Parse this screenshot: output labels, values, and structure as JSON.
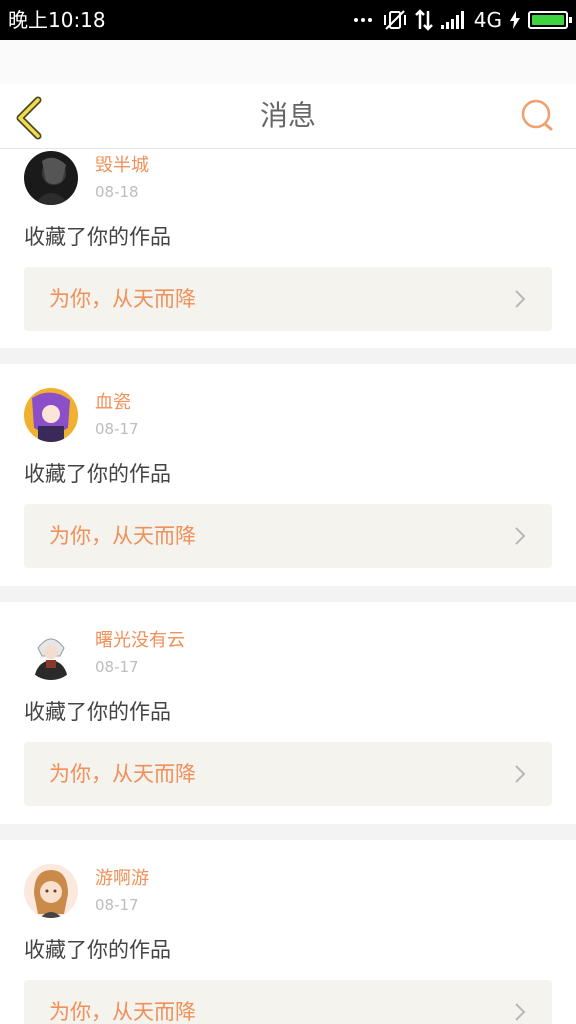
{
  "status_bar": {
    "time": "晚上10:18",
    "network": "4G",
    "icons": [
      "more-dots-icon",
      "vibrate-off-icon",
      "data-transfer-icon",
      "signal-icon",
      "battery-charging-icon"
    ],
    "battery_level": 1.0,
    "battery_color": "#3fd33f"
  },
  "header": {
    "title": "消息",
    "back_icon": "chevron-left-icon",
    "search_icon": "search-icon",
    "accent_color": "#f0905a"
  },
  "messages": [
    {
      "username": "毁半城",
      "date": "08-18",
      "action": "收藏了你的作品",
      "work_title": "为你，从天而降",
      "avatar": "avatar-dark-portrait"
    },
    {
      "username": "血瓷",
      "date": "08-17",
      "action": "收藏了你的作品",
      "work_title": "为你，从天而降",
      "avatar": "avatar-purple-anime"
    },
    {
      "username": "曙光没有云",
      "date": "08-17",
      "action": "收藏了你的作品",
      "work_title": "为你，从天而降",
      "avatar": "avatar-white-hair-anime"
    },
    {
      "username": "游啊游",
      "date": "08-17",
      "action": "收藏了你的作品",
      "work_title": "为你，从天而降",
      "avatar": "avatar-girl-anime"
    }
  ]
}
